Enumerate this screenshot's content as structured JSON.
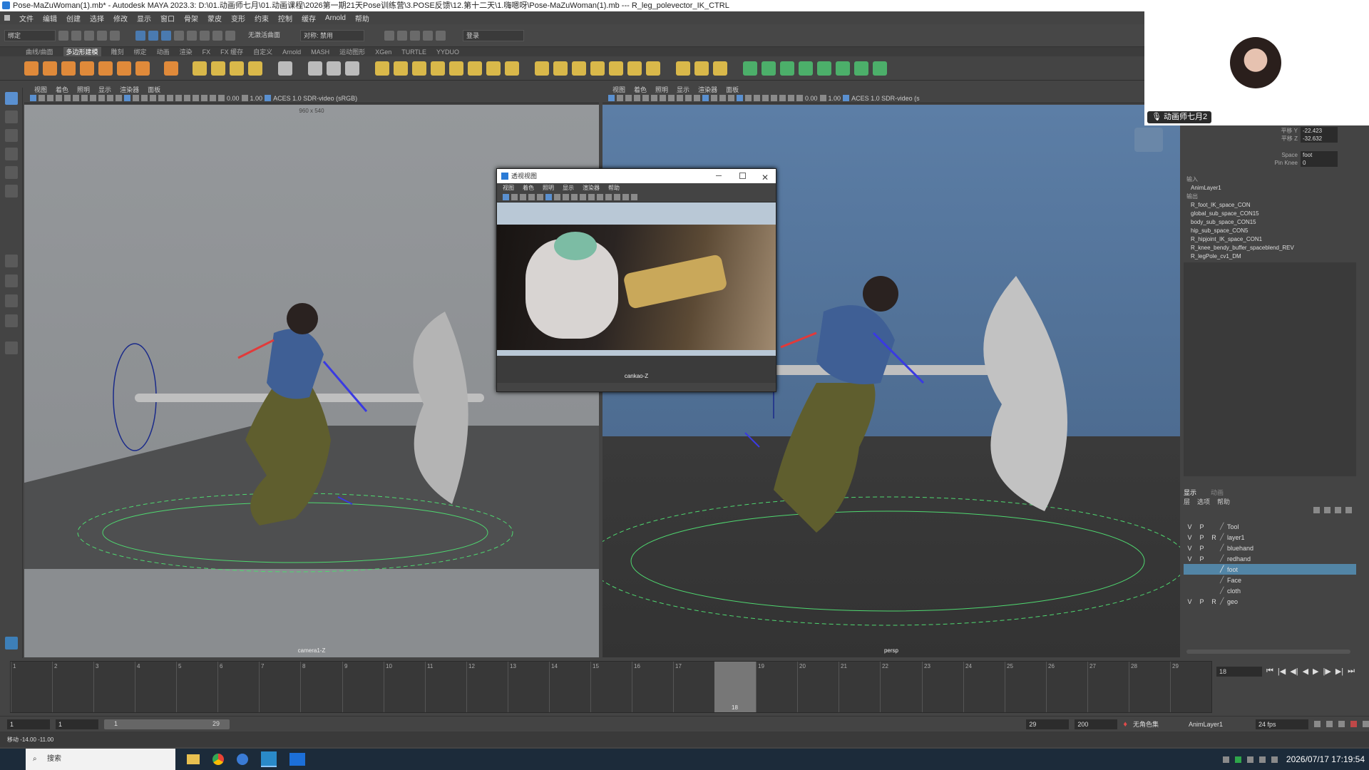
{
  "window": {
    "title": "Pose-MaZuWoman(1).mb* - Autodesk MAYA 2023.3: D:\\01.动画师七月\\01.动画课程\\2026第一期21天Pose训练营\\3.POSE反馈\\12.第十二天\\1.嗨嗯呀\\Pose-MaZuWoman(1).mb   ---   R_leg_polevector_IK_CTRL"
  },
  "menubar": [
    "文件",
    "编辑",
    "创建",
    "选择",
    "修改",
    "显示",
    "窗口",
    "骨架",
    "蒙皮",
    "变形",
    "约束",
    "控制",
    "缓存",
    "Arnold",
    "帮助"
  ],
  "status_line": {
    "mode": "绑定",
    "no_live": "无激活曲面",
    "symmetry": "对称: 禁用",
    "login": "登录"
  },
  "shelf_tabs": [
    "曲线/曲面",
    "多边形建模",
    "雕刻",
    "绑定",
    "动画",
    "渲染",
    "FX",
    "FX 缓存",
    "自定义",
    "Arnold",
    "MASH",
    "运动图形",
    "XGen",
    "TURTLE",
    "YYDUO"
  ],
  "shelf_active": "多边形建模",
  "viewport_left": {
    "menu": [
      "视图",
      "着色",
      "照明",
      "显示",
      "渲染器",
      "面板"
    ],
    "exposure": "0.00",
    "gamma": "1.00",
    "colorspace": "ACES 1.0 SDR-video (sRGB)",
    "res_label": "960 x 540",
    "camera": "camera1-Z"
  },
  "viewport_right": {
    "menu": [
      "视图",
      "着色",
      "照明",
      "显示",
      "渲染器",
      "面板"
    ],
    "exposure": "0.00",
    "gamma": "1.00",
    "colorspace": "ACES 1.0 SDR-video (s",
    "camera": "persp"
  },
  "floating_panel": {
    "title": "透视视图",
    "menu": [
      "视图",
      "着色",
      "照明",
      "显示",
      "渲染器",
      "帮助"
    ],
    "camera": "cankao-Z"
  },
  "webcam": {
    "name": "动画师七月2"
  },
  "channel_box": {
    "attrs": [
      {
        "label": "平移 Y",
        "value": "-22.423"
      },
      {
        "label": "平移 Z",
        "value": "-32.632"
      },
      {
        "label": "Space",
        "value": "foot"
      },
      {
        "label": "Pin Knee",
        "value": "0"
      }
    ],
    "section_inputs": "输入",
    "input_items": [
      "AnimLayer1"
    ],
    "section_outputs": "输出",
    "output_items": [
      "R_foot_IK_space_CON",
      "global_sub_space_CON15",
      "body_sub_space_CON15",
      "hip_sub_space_CON5",
      "R_hipjoint_IK_space_CON1",
      "R_knee_bendy_buffer_spaceblend_REV",
      "R_legPole_cv1_DM"
    ]
  },
  "layer_editor": {
    "tabs": [
      "显示",
      "动画"
    ],
    "menu": [
      "层",
      "选项",
      "帮助"
    ],
    "layers": [
      {
        "v": "V",
        "p": "P",
        "r": "",
        "name": "Tool",
        "selected": false
      },
      {
        "v": "V",
        "p": "P",
        "r": "R",
        "name": "layer1",
        "selected": false
      },
      {
        "v": "V",
        "p": "P",
        "r": "",
        "name": "bluehand",
        "selected": false
      },
      {
        "v": "V",
        "p": "P",
        "r": "",
        "name": "redhand",
        "selected": false
      },
      {
        "v": "",
        "p": "",
        "r": "",
        "name": "foot",
        "selected": true
      },
      {
        "v": "",
        "p": "",
        "r": "",
        "name": "Face",
        "selected": false
      },
      {
        "v": "",
        "p": "",
        "r": "",
        "name": "cloth",
        "selected": false
      },
      {
        "v": "V",
        "p": "P",
        "r": "R",
        "name": "geo",
        "selected": false
      }
    ]
  },
  "timeline": {
    "ticks": [
      "1",
      "2",
      "3",
      "4",
      "5",
      "6",
      "7",
      "8",
      "9",
      "10",
      "11",
      "12",
      "13",
      "14",
      "15",
      "16",
      "17",
      "18",
      "19",
      "20",
      "21",
      "22",
      "23",
      "24",
      "25",
      "26",
      "27",
      "28",
      "29"
    ],
    "current_frame": "18",
    "current_field": "18",
    "current_index": 17
  },
  "range": {
    "start": "1",
    "start2": "1",
    "slider_start": "1",
    "slider_end": "29",
    "end": "29",
    "end2": "200",
    "char_set": "无角色集",
    "anim_layer": "AnimLayer1",
    "fps": "24 fps"
  },
  "cmdline": {
    "text": "移动  -14.00  -11.00"
  },
  "taskbar": {
    "search": "搜索",
    "datetime": "2026/07/17 17:19:54"
  }
}
